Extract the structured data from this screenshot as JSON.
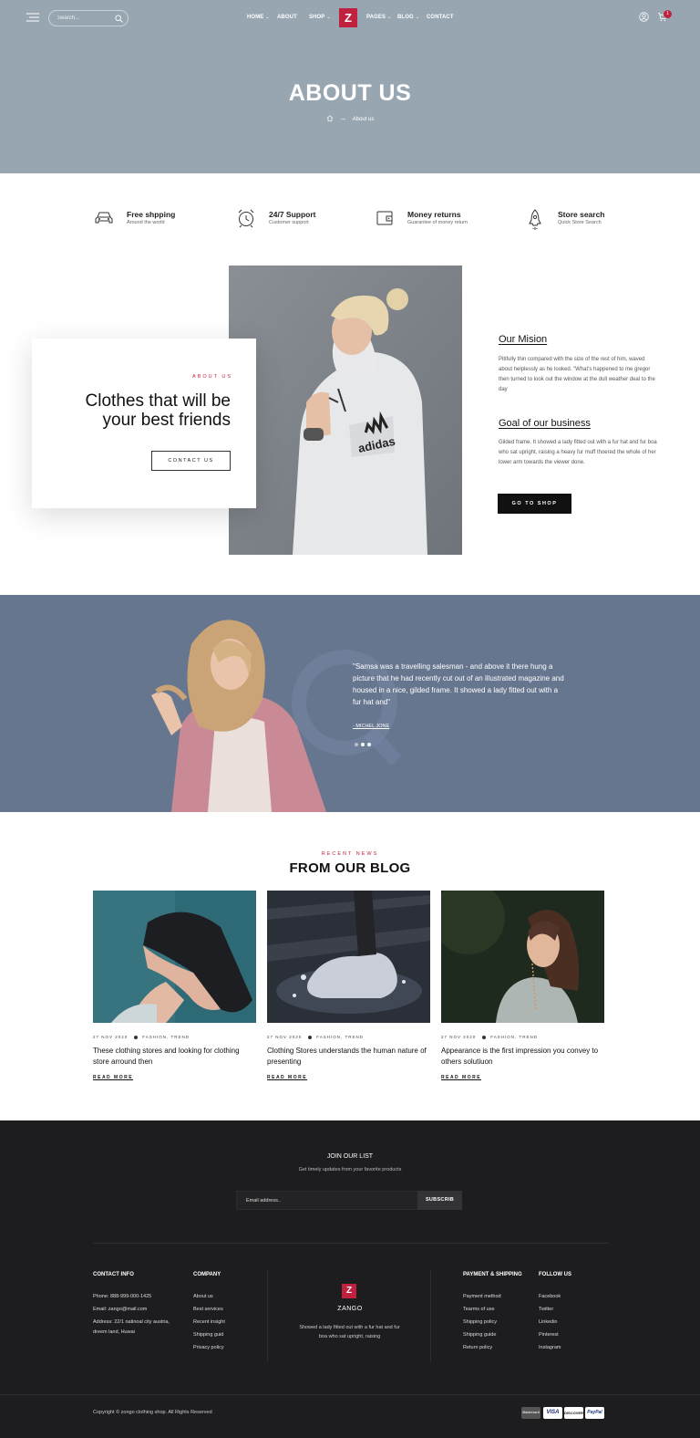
{
  "header": {
    "search_placeholder": "Search...",
    "nav": [
      "HOME",
      "ABOUT",
      "SHOP",
      "PAGES",
      "BLOG",
      "CONTACT"
    ],
    "logo": "Z",
    "cart_count": "1"
  },
  "hero": {
    "title": "ABOUT US",
    "breadcrumb_current": "About us"
  },
  "features": [
    {
      "title": "Free shpping",
      "subtitle": "Around the world",
      "icon": "car-icon"
    },
    {
      "title": "24/7 Support",
      "subtitle": "Customer support",
      "icon": "alarm-clock-icon"
    },
    {
      "title": "Money returns",
      "subtitle": "Guarantee of money return",
      "icon": "wallet-icon"
    },
    {
      "title": "Store search",
      "subtitle": "Quick Store Search",
      "icon": "rocket-icon"
    }
  ],
  "about": {
    "eyebrow": "ABOUT US",
    "title": "Clothes that will be your best friends",
    "contact_button": "CONTACT US",
    "mission_title": "Our Mision",
    "mission_text": "Pitifully thin compared with the size of the rest of him, waved about helplessly as he looked. \"What's happened to me  gregor then turned to look out the window at the dull weather deal to the day",
    "goal_title": "Goal of our business",
    "goal_text": "Gilded frame. It showed a lady fitted out with a fur hat and fur boa who sat upright, raising a heavy fur muff thoered the whole of her lower arm towards the viewer done.",
    "shop_button": "GO TO SHOP"
  },
  "testimonial": {
    "quote": "\"Samsa was a travelling salesman - and above it there hung a picture that he had recently cut out of an illustrated magazine and housed in a nice, gilded frame. It showed a lady fitted out with a fur hat and\"",
    "author": "- MICHEL JONE"
  },
  "blog": {
    "eyebrow": "RECENT NEWS",
    "title": "FROM OUR BLOG",
    "posts": [
      {
        "date": "27 NOV 2020",
        "tags": "FASHION, TREND",
        "title": "These clothing stores and looking for clothing store arround then",
        "read_more": "READ MORE"
      },
      {
        "date": "27 NOV 2020",
        "tags": "FASHION, TREND",
        "title": "Clothing Stores understands the human nature of presenting",
        "read_more": "READ MORE"
      },
      {
        "date": "27 NOV 2020",
        "tags": "FASHION, TREND",
        "title": "Appearance is the first impression you convey to others solutiuon",
        "read_more": "READ MORE"
      }
    ]
  },
  "footer": {
    "join_title": "JOIN OUR LIST",
    "join_subtitle": "Get timely updates from your favorite products",
    "email_placeholder": "Email address..",
    "subscribe": "SUBSCRIB",
    "contact_title": "CONTACT INFO",
    "contact_phone": "Phone: 888-999-000-1425",
    "contact_email": "Email: zango@mail.com",
    "contact_address": "Address: 22/1 natinoal city austria, dreem land, Huwai",
    "company_title": "COMPANY",
    "company_links": [
      "About us",
      "Best services",
      "Recent insight",
      "Shipping guid",
      "Privacy policy"
    ],
    "brand_logo": "Z",
    "brand_name": "ZANGO",
    "brand_desc": "Showed a lady fitted out with a fur hat and fur boa who sat upright, raising",
    "payment_title": "PAYMENT & SHIPPING",
    "payment_links": [
      "Payment method",
      "Tearms of use",
      "Shipping policy",
      "Shipping guide",
      "Return policy"
    ],
    "follow_title": "FOLLOW US",
    "follow_links": [
      "Facebook",
      "Twitter",
      "Linkedin",
      "Pinterest",
      "Instagram"
    ],
    "copyright": "Copyright © zongo clothing shop. All Rights Reserved",
    "payment_badges": [
      "Mastercard",
      "VISA",
      "DISCOVER",
      "PayPal"
    ]
  },
  "colors": {
    "accent": "#c0213f",
    "hero_bg": "#98a6b2",
    "testimonial_bg": "#67768f",
    "footer_bg": "#1d1d1f"
  }
}
